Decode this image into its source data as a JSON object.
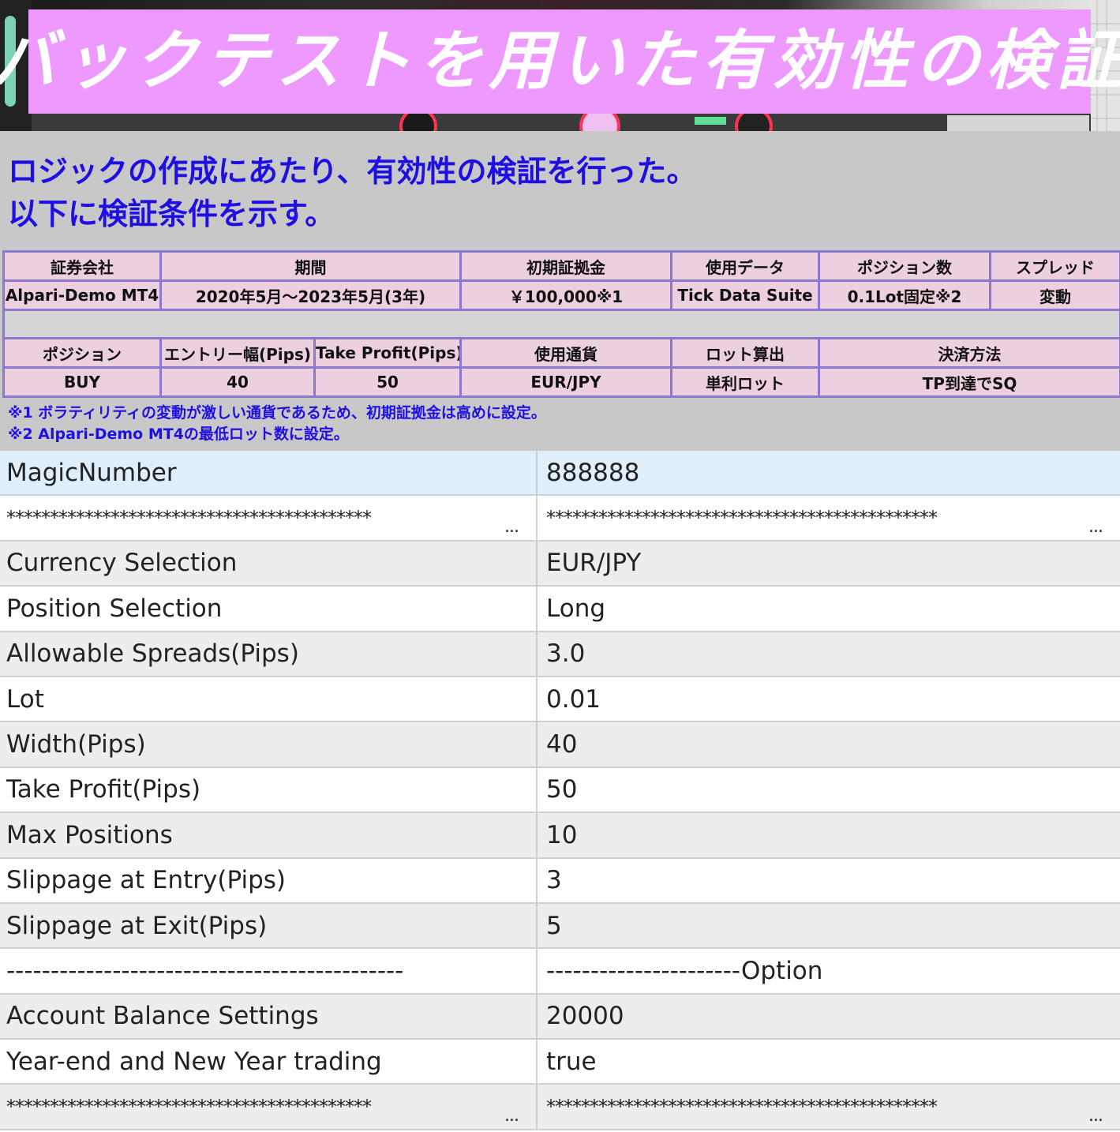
{
  "banner": {
    "title": "バックテストを用いた有効性の検証"
  },
  "intro": {
    "line1": "ロジックの作成にあたり、有効性の検証を行った。",
    "line2": "以下に検証条件を示す。"
  },
  "conditions": {
    "row1": {
      "headers": [
        "証券会社",
        "期間",
        "初期証拠金",
        "使用データ",
        "ポジション数",
        "スプレッド"
      ],
      "values": [
        "Alpari-Demo MT4",
        "2020年5月～2023年5月(3年)",
        "￥100,000※1",
        "Tick Data Suite",
        "0.1Lot固定※2",
        "変動"
      ]
    },
    "row2": {
      "headers": [
        "ポジション",
        "エントリー幅(Pips)",
        "Take Profit(Pips)",
        "使用通貨",
        "ロット算出",
        "決済方法"
      ],
      "values": [
        "BUY",
        "40",
        "50",
        "EUR/JPY",
        "単利ロット",
        "TP到達でSQ"
      ]
    }
  },
  "notes": {
    "note1": "※1 ボラティリティの変動が激しい通貨であるため、初期証拠金は高めに設定。",
    "note2": "※2 Alpari-Demo MT4の最低ロット数に設定。"
  },
  "params": {
    "rows": [
      {
        "name": "MagicNumber",
        "value": "888888"
      },
      {
        "name": "******************************************",
        "value": "*********************************************",
        "name_ellipsis": "...",
        "value_ellipsis": "..."
      },
      {
        "name": "Currency Selection",
        "value": "EUR/JPY"
      },
      {
        "name": "Position Selection",
        "value": "Long"
      },
      {
        "name": "Allowable Spreads(Pips)",
        "value": "3.0"
      },
      {
        "name": "Lot",
        "value": "0.01"
      },
      {
        "name": "Width(Pips)",
        "value": "40"
      },
      {
        "name": "Take Profit(Pips)",
        "value": "50"
      },
      {
        "name": "Max Positions",
        "value": "10"
      },
      {
        "name": "Slippage at Entry(Pips)",
        "value": "3"
      },
      {
        "name": "Slippage at Exit(Pips)",
        "value": "5"
      },
      {
        "name": "---------------------------------------------",
        "value": "----------------------Option"
      },
      {
        "name": "Account Balance Settings",
        "value": "20000"
      },
      {
        "name": "Year-end and New Year trading",
        "value": "true"
      },
      {
        "name": "******************************************",
        "value": "*********************************************",
        "name_ellipsis": "...",
        "value_ellipsis": "..."
      }
    ]
  },
  "colors": {
    "banner_box": "#ee99ff",
    "intro_text": "#1e10e0",
    "table_border": "#8c78d0",
    "table_fill": "#ecd0e0",
    "section_bg": "#c8c8c8",
    "highlight_row": "#dff0fc"
  }
}
